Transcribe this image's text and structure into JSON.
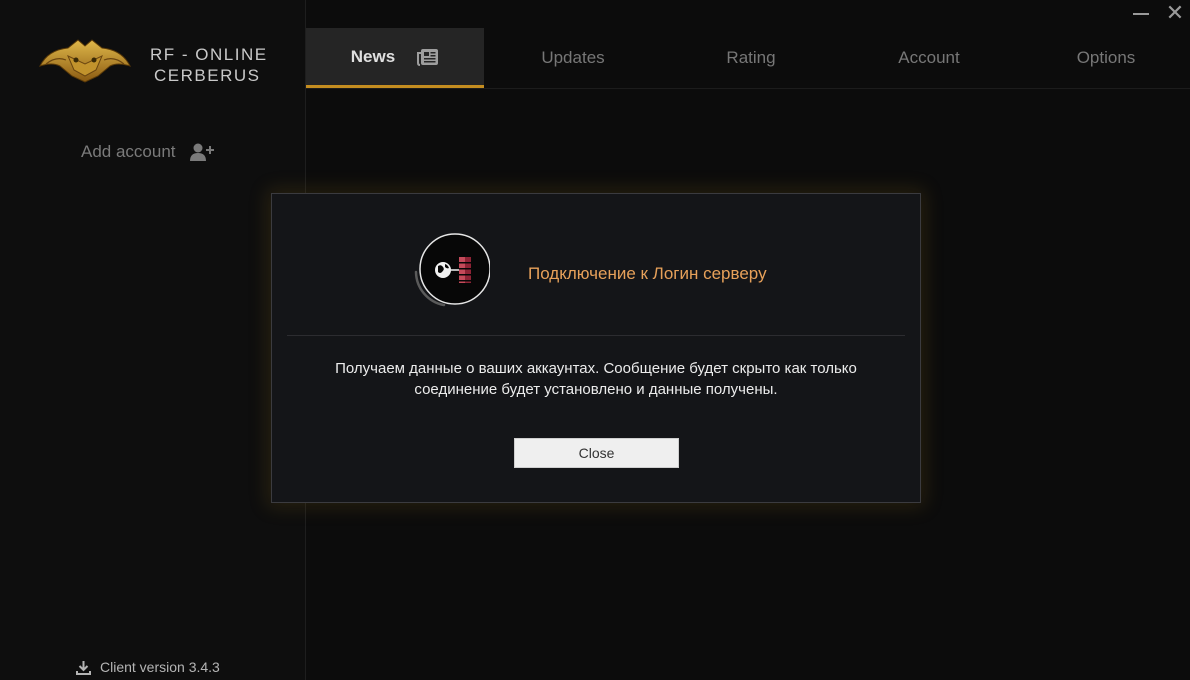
{
  "window": {
    "minimize_icon": "minimize-icon",
    "close_glyph": "✕"
  },
  "sidebar": {
    "brand_line1": "RF - ONLINE",
    "brand_line2": "CERBERUS",
    "add_account_label": "Add account",
    "client_version_label": "Client version 3.4.3"
  },
  "nav": {
    "tabs": [
      {
        "label": "News",
        "active": true
      },
      {
        "label": "Updates",
        "active": false
      },
      {
        "label": "Rating",
        "active": false
      },
      {
        "label": "Account",
        "active": false
      },
      {
        "label": "Options",
        "active": false
      }
    ]
  },
  "modal": {
    "title": "Подключение к Логин серверу",
    "message_line1": "Получаем данные о ваших аккаунтах. Сообщение будет скрыто как только",
    "message_line2": "соединение будет установлено и данные получены.",
    "close_label": "Close"
  },
  "colors": {
    "accent": "#c48d20",
    "modal_title": "#e7a15a",
    "background": "#0c0c0c"
  }
}
